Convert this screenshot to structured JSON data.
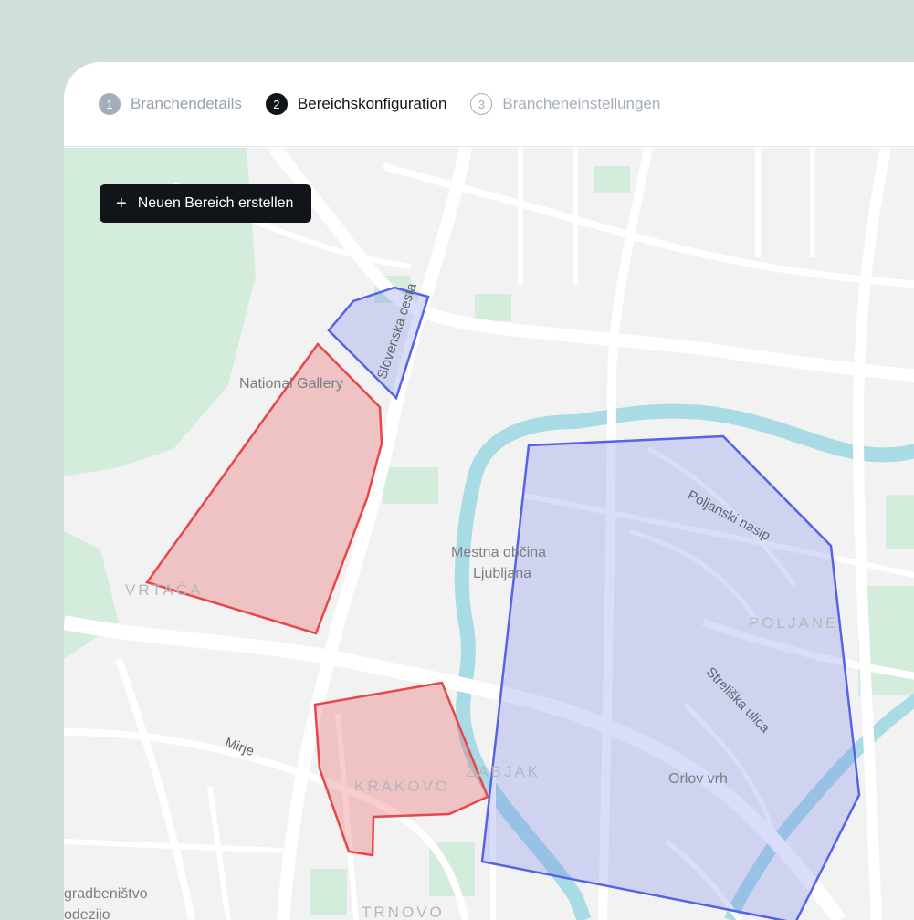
{
  "steps": [
    {
      "number": "1",
      "label": "Branchendetails",
      "state": "done"
    },
    {
      "number": "2",
      "label": "Bereichskonfiguration",
      "state": "active"
    },
    {
      "number": "3",
      "label": "Brancheneinstellungen",
      "state": "todo"
    }
  ],
  "toolbar": {
    "create_area_label": "Neuen Bereich erstellen",
    "create_icon": "plus-icon"
  },
  "map": {
    "labels": {
      "national_gallery": "National Gallery",
      "slovenska_cesta": "Slovenska cesta",
      "mestna_obcina": "Mestna občina",
      "ljubljana": "Ljubljana",
      "poljanski_nasip": "Poljanski nasip",
      "vrtaca": "VRTAČA",
      "poljane": "POLJANE",
      "streliska_ulica": "Streliška ulica",
      "mirje": "Mirje",
      "krakovo": "KRAKOVO",
      "zabjak": "ZABJAK",
      "orlov_vrh": "Orlov vrh",
      "gradbenistvo": "gradbeništvo",
      "odezijo": "odezijo",
      "trnovo": "TRNOVO"
    },
    "colors": {
      "red_area": "#e8474a",
      "blue_area": "#5563e8",
      "river": "#a9dbe4",
      "park": "#d4ecdb",
      "road": "#ffffff",
      "background": "#f2f2f2"
    }
  }
}
